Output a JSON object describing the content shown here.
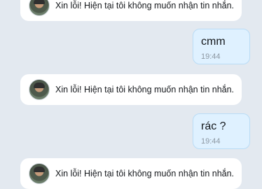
{
  "messages": [
    {
      "kind": "auto_reply",
      "text": "Xin lỗi! Hiện tại tôi không muốn nhận tin nhắn."
    },
    {
      "kind": "outgoing",
      "text": "cmm",
      "time": "19:44"
    },
    {
      "kind": "auto_reply",
      "text": "Xin lỗi! Hiện tại tôi không muốn nhận tin nhắn."
    },
    {
      "kind": "outgoing",
      "text": "rác ?",
      "time": "19:44"
    },
    {
      "kind": "auto_reply",
      "text": "Xin lỗi! Hiện tại tôi không muốn nhận tin nhắn."
    }
  ],
  "colors": {
    "background": "#e3e9f0",
    "outgoing_bubble": "#dff1ff",
    "incoming_bubble": "#ffffff"
  }
}
